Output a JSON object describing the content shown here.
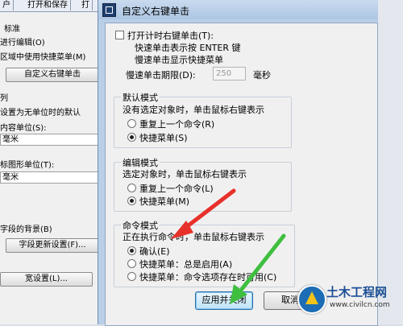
{
  "options_window": {
    "tabs": [
      "户",
      "打开和保存",
      "打"
    ],
    "texts": {
      "standard": "标准",
      "edit_mode": "进行编辑(O)",
      "shortcut_in_area": "区域中使用快捷菜单(M)",
      "default_section": "列",
      "unitless_default": "设置为无单位时的默认",
      "content_unit": "内容单位(S):",
      "content_unit_value": "毫米",
      "target_unit": "标图形单位(T):",
      "target_unit_value": "毫米",
      "field_bg": "字段的背景(B)"
    },
    "buttons": {
      "right_click": "自定义右键单击",
      "field_update": "字段更新设置(F)...",
      "lineweight": "宽设置(L)..."
    }
  },
  "dialog": {
    "title": "自定义右键单击",
    "close_glyph": "✕",
    "timed_right_click": {
      "label": "打开计时右键单击(T):",
      "line1": "快速单击表示按 ENTER 键",
      "line2": "慢速单击显示快捷菜单",
      "duration_label": "慢速单击期限(D):",
      "duration_value": "250",
      "duration_unit": "毫秒",
      "checked": false
    },
    "default_mode": {
      "title": "默认模式",
      "desc": "没有选定对象时，单击鼠标右键表示",
      "options": [
        "重复上一个命令(R)",
        "快捷菜单(S)"
      ],
      "selected": 1
    },
    "edit_mode": {
      "title": "编辑模式",
      "desc": "选定对象时，单击鼠标右键表示",
      "options": [
        "重复上一个命令(L)",
        "快捷菜单(M)"
      ],
      "selected": 1
    },
    "command_mode": {
      "title": "命令模式",
      "desc": "正在执行命令时，单击鼠标右键表示",
      "options": [
        "确认(E)",
        "快捷菜单：总是启用(A)",
        "快捷菜单：命令选项存在时可用(C)"
      ],
      "selected": 0
    },
    "buttons": {
      "apply_close": "应用并关闭",
      "cancel": "取消"
    }
  },
  "watermark": {
    "name": "土木工程网",
    "url": "www.civilcn.com"
  },
  "colors": {
    "annotation_red": "#e8302a",
    "annotation_green": "#3fbf3f"
  }
}
